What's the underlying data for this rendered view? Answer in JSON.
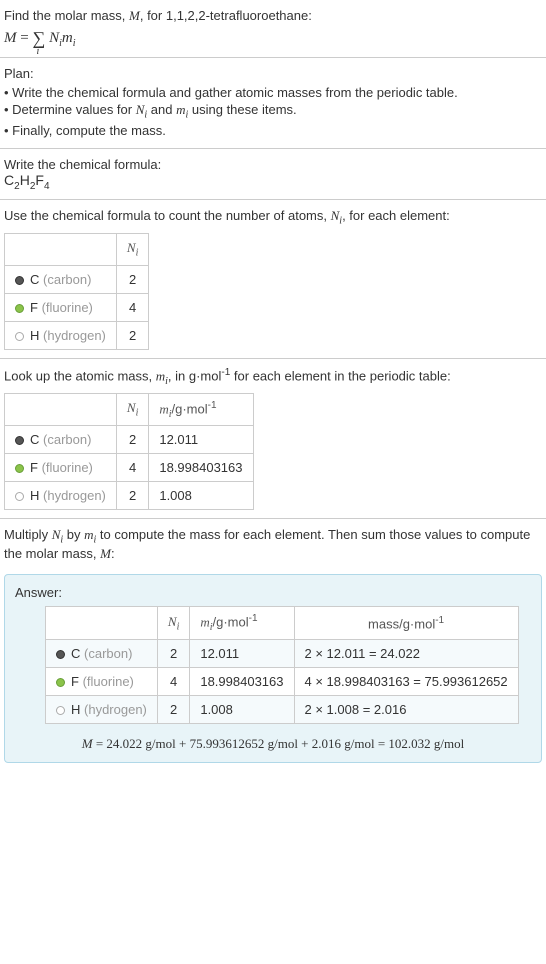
{
  "intro": {
    "line1": "Find the molar mass, ",
    "line1_var": "M",
    "line1_end": ", for 1,1,2,2-tetrafluoroethane:",
    "formula_lhs": "M",
    "formula_eq": " = ",
    "sum_sub": "i",
    "formula_rhs1": "N",
    "formula_rhs1_sub": "i",
    "formula_rhs2": "m",
    "formula_rhs2_sub": "i"
  },
  "plan": {
    "title": "Plan:",
    "items": [
      "• Write the chemical formula and gather atomic masses from the periodic table.",
      "• Determine values for ",
      "• Finally, compute the mass."
    ],
    "item1_var1": "N",
    "item1_sub1": "i",
    "item1_mid": " and ",
    "item1_var2": "m",
    "item1_sub2": "i",
    "item1_end": " using these items."
  },
  "chem_formula": {
    "title": "Write the chemical formula:",
    "c": "C",
    "c_n": "2",
    "h": "H",
    "h_n": "2",
    "f": "F",
    "f_n": "4"
  },
  "count_section": {
    "title_a": "Use the chemical formula to count the number of atoms, ",
    "title_var": "N",
    "title_sub": "i",
    "title_b": ", for each element:",
    "header_n": "N",
    "header_n_sub": "i",
    "rows": [
      {
        "sym": "C",
        "name": "(carbon)",
        "dot": "dot-c",
        "n": "2"
      },
      {
        "sym": "F",
        "name": "(fluorine)",
        "dot": "dot-f",
        "n": "4"
      },
      {
        "sym": "H",
        "name": "(hydrogen)",
        "dot": "dot-h",
        "n": "2"
      }
    ]
  },
  "mass_section": {
    "title_a": "Look up the atomic mass, ",
    "title_var": "m",
    "title_sub": "i",
    "title_b": ", in g·mol",
    "title_sup": "-1",
    "title_c": " for each element in the periodic table:",
    "header_m": "m",
    "header_m_sub": "i",
    "header_unit": "/g·mol",
    "header_unit_sup": "-1",
    "rows": [
      {
        "sym": "C",
        "name": "(carbon)",
        "dot": "dot-c",
        "n": "2",
        "m": "12.011"
      },
      {
        "sym": "F",
        "name": "(fluorine)",
        "dot": "dot-f",
        "n": "4",
        "m": "18.998403163"
      },
      {
        "sym": "H",
        "name": "(hydrogen)",
        "dot": "dot-h",
        "n": "2",
        "m": "1.008"
      }
    ]
  },
  "multiply_section": {
    "title_a": "Multiply ",
    "var1": "N",
    "sub1": "i",
    "title_b": " by ",
    "var2": "m",
    "sub2": "i",
    "title_c": " to compute the mass for each element. Then sum those values to compute the molar mass, ",
    "var3": "M",
    "title_d": ":"
  },
  "answer": {
    "label": "Answer:",
    "header_mass": "mass/g·mol",
    "header_mass_sup": "-1",
    "rows": [
      {
        "sym": "C",
        "name": "(carbon)",
        "dot": "dot-c",
        "n": "2",
        "m": "12.011",
        "calc": "2 × 12.011 = 24.022"
      },
      {
        "sym": "F",
        "name": "(fluorine)",
        "dot": "dot-f",
        "n": "4",
        "m": "18.998403163",
        "calc": "4 × 18.998403163 = 75.993612652"
      },
      {
        "sym": "H",
        "name": "(hydrogen)",
        "dot": "dot-h",
        "n": "2",
        "m": "1.008",
        "calc": "2 × 1.008 = 2.016"
      }
    ],
    "final_var": "M",
    "final_eq": " = ",
    "final_rhs": "24.022 g/mol + 75.993612652 g/mol + 2.016 g/mol = 102.032 g/mol"
  }
}
